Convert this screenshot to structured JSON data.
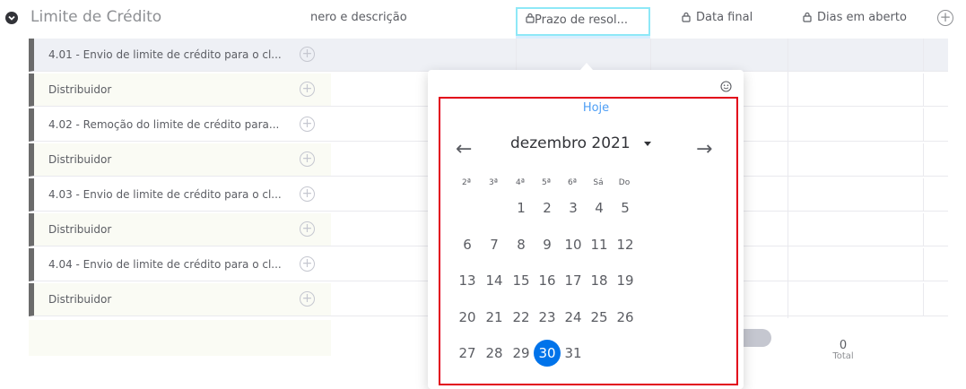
{
  "header": {
    "group_title": "Limite de Crédito",
    "col_number_desc": "nero e descrição",
    "col_prazo": "Prazo de resol...",
    "col_data_final": "Data final",
    "col_dias": "Dias em aberto",
    "add_col_label": "+"
  },
  "rows": [
    {
      "name": "4.01 - Envio de limite de crédito para o cl..."
    },
    {
      "name": "Distribuidor"
    },
    {
      "name": "4.02 - Remoção do limite de crédito para..."
    },
    {
      "name": "Distribuidor"
    },
    {
      "name": "4.03 - Envio de limite de crédito para o cl..."
    },
    {
      "name": "Distribuidor"
    },
    {
      "name": "4.04 - Envio de limite de crédito para o cl..."
    },
    {
      "name": "Distribuidor"
    }
  ],
  "add_item_label": "+",
  "summary": {
    "value": "0",
    "label": "Total"
  },
  "datepicker": {
    "today": "Hoje",
    "month_year": "dezembro 2021",
    "prev_arrow": "←",
    "next_arrow": "→",
    "weekdays": [
      "2ª",
      "3ª",
      "4ª",
      "5ª",
      "6ª",
      "Sá",
      "Do"
    ],
    "weeks": [
      [
        "",
        "",
        "1",
        "2",
        "3",
        "4",
        "5"
      ],
      [
        "6",
        "7",
        "8",
        "9",
        "10",
        "11",
        "12"
      ],
      [
        "13",
        "14",
        "15",
        "16",
        "17",
        "18",
        "19"
      ],
      [
        "20",
        "21",
        "22",
        "23",
        "24",
        "25",
        "26"
      ],
      [
        "27",
        "28",
        "29",
        "30",
        "31",
        "",
        ""
      ]
    ],
    "selected_day": "30"
  },
  "colors": {
    "accent": "#0073ea",
    "highlight_frame": "#e2001a",
    "cursor_frame": "#8ee8f7",
    "row_bar": "#6b6b6b"
  },
  "icons": {
    "group_toggle": "circle-chevron-down-icon",
    "lock": "lock-icon",
    "add": "plus-circle-icon",
    "smiley": "smiley-icon"
  }
}
